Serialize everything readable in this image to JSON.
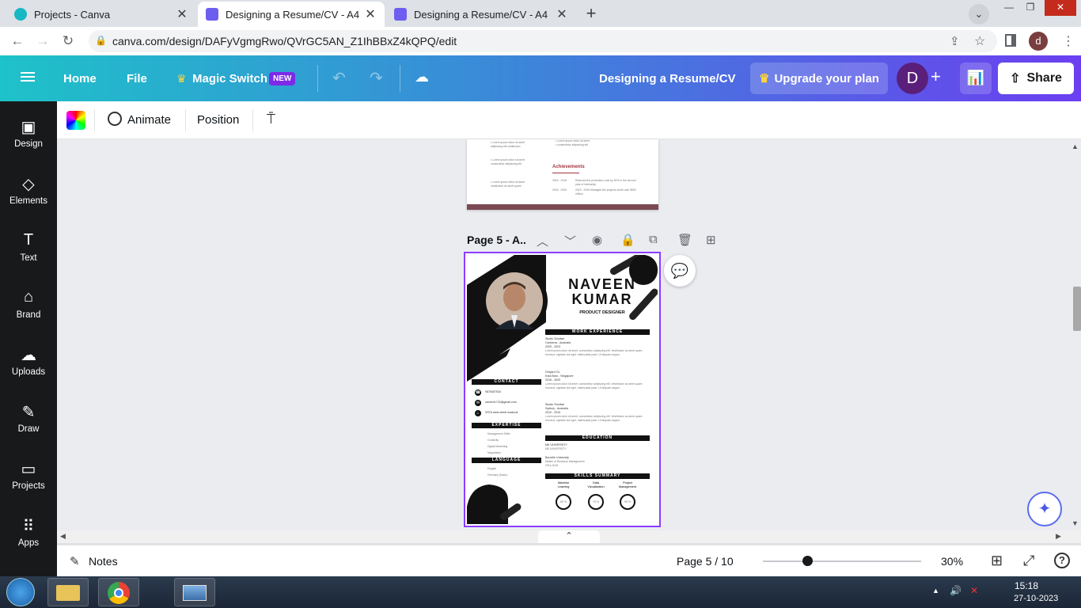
{
  "browser": {
    "tabs": [
      {
        "title": "Projects - Canva",
        "active": false
      },
      {
        "title": "Designing a Resume/CV - A4",
        "active": true
      },
      {
        "title": "Designing a Resume/CV - A4",
        "active": false
      }
    ],
    "url": "canva.com/design/DAFyVgmgRwo/QVrGC5AN_Z1IhBBxZ4kQPQ/edit",
    "profile_initial": "d"
  },
  "header": {
    "home": "Home",
    "file": "File",
    "magic_switch": "Magic Switch",
    "new_badge": "NEW",
    "doc_title": "Designing a Resume/CV",
    "upgrade": "Upgrade your plan",
    "user_initial": "D",
    "share": "Share"
  },
  "sidebar": {
    "items": [
      {
        "label": "Design",
        "icon": "design-icon"
      },
      {
        "label": "Elements",
        "icon": "elements-icon"
      },
      {
        "label": "Text",
        "icon": "text-icon"
      },
      {
        "label": "Brand",
        "icon": "brand-icon"
      },
      {
        "label": "Uploads",
        "icon": "uploads-icon"
      },
      {
        "label": "Draw",
        "icon": "draw-icon"
      },
      {
        "label": "Projects",
        "icon": "projects-icon"
      },
      {
        "label": "Apps",
        "icon": "apps-icon"
      }
    ]
  },
  "context_toolbar": {
    "animate": "Animate",
    "position": "Position"
  },
  "canvas": {
    "page_label": "Page 5 - A..",
    "prev_page": {
      "achievements_title": "Achievements",
      "rows": [
        {
          "years": "2015 - 2016",
          "text": "Reduced the production cost by 30% in the second year of internship"
        },
        {
          "years": "2018 - 2020",
          "text": "2019 - 2020 Managed the projects worth over $900 million"
        }
      ]
    },
    "resume": {
      "first_name": "NAVEEN",
      "last_name": "KUMAR",
      "role": "PRODUCT DESIGNER",
      "work_experience_title": "WORK EXPERIENCE",
      "jobs": [
        {
          "company": "Studio Shodwe",
          "location": "Canberra - Australia",
          "years": "2020 - 2023"
        },
        {
          "company": "Ginyard Co.",
          "location": "Kota Baru - Singapore",
          "years": "2016 - 2020"
        },
        {
          "company": "Studio Shodwe",
          "location": "Sydney - Australia",
          "years": "2010 - 2015"
        }
      ],
      "job_desc": "Lorem ipsum dolor sit amet, consectetur adipiscing elit. Vestibulum ac amet quam rhoncus, egestas dui eget, malesuada justo. Ut aliquam augue.",
      "contact_title": "CONTACT",
      "contact": {
        "phone": "9876457534",
        "email": "naveen1732@gmail.com",
        "address": "SSTA west street madurai"
      },
      "expertise_title": "EXPERTISE",
      "expertise": [
        "Management Skills",
        "Creativity",
        "Digital Marketing",
        "Negotiation"
      ],
      "language_title": "LANGUAGE",
      "languages": [
        "English",
        "Germany (basic)"
      ],
      "education_title": "EDUCATION",
      "education": [
        {
          "school": "MK UNIVERSITY",
          "detail": "MK UNIVERSITY"
        },
        {
          "school": "Borcelle University",
          "detail": "Master of Business Management",
          "years": "2014-2018"
        }
      ],
      "skills_title": "SKILLS SUMMARY",
      "skills": [
        {
          "name": "Machine Learning",
          "value": "65 %"
        },
        {
          "name": "Data Visualization",
          "value": "75 %"
        },
        {
          "name": "Project Management",
          "value": "95 %"
        }
      ]
    }
  },
  "bottom_bar": {
    "notes": "Notes",
    "page_indicator": "Page 5 / 10",
    "zoom": "30%",
    "zoom_fraction": 0.28
  },
  "taskbar": {
    "time": "15:18",
    "date": "27-10-2023"
  }
}
